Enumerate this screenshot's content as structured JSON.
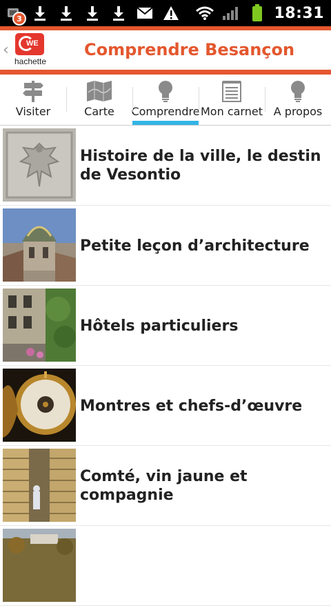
{
  "status_bar": {
    "notification_count": "3",
    "time": "18:31",
    "icons": [
      "notification-icon",
      "download-icon",
      "download-icon",
      "download-icon",
      "download-icon",
      "mail-icon",
      "warning-icon",
      "wifi-icon",
      "signal-icon",
      "battery-icon"
    ]
  },
  "header": {
    "back_chevron": "‹",
    "logo_mark": "WE",
    "logo_text": "hachette",
    "title": "Comprendre Besançon",
    "accent_color": "#e4572e"
  },
  "tabs": [
    {
      "label": "Visiter",
      "icon": "signpost-icon",
      "active": false
    },
    {
      "label": "Carte",
      "icon": "map-icon",
      "active": false
    },
    {
      "label": "Comprendre",
      "icon": "lightbulb-icon",
      "active": true
    },
    {
      "label": "Mon carnet",
      "icon": "notebook-icon",
      "active": false
    },
    {
      "label": "A propos",
      "icon": "lightbulb-icon",
      "active": false
    }
  ],
  "tab_active_color": "#33b5e5",
  "items": [
    {
      "title": "Histoire de la ville, le destin de Vesontio",
      "thumb": "eagle-relief"
    },
    {
      "title": "Petite leçon d’architecture",
      "thumb": "dome"
    },
    {
      "title": "Hôtels particuliers",
      "thumb": "courtyard"
    },
    {
      "title": "Montres et chefs-d’œuvre",
      "thumb": "watch"
    },
    {
      "title": "Comté, vin jaune et compagnie",
      "thumb": "cheese-cellar"
    },
    {
      "title": "",
      "thumb": "landscape"
    }
  ]
}
